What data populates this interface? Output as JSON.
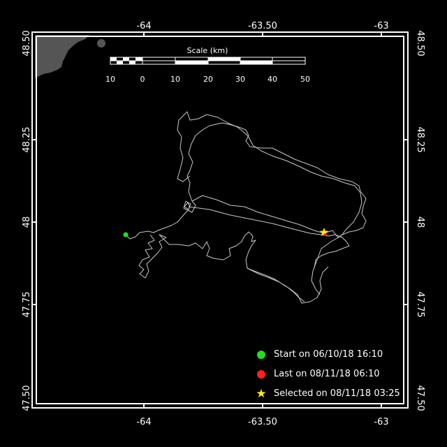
{
  "map": {
    "top_ticks": [
      "-64",
      "-63.50",
      "-63"
    ],
    "bottom_ticks": [
      "-64",
      "-63.50",
      "-63"
    ],
    "left_ticks": [
      "48.50",
      "48.25",
      "48",
      "47.75",
      "47.50"
    ],
    "right_ticks": [
      "48.50",
      "48.25",
      "48",
      "47.75",
      "47.50"
    ],
    "scale": {
      "title": "Scale (km)",
      "labels": [
        "10",
        "0",
        "10",
        "20",
        "30",
        "40",
        "50"
      ]
    },
    "colors": {
      "background": "#000000",
      "frame": "#ffffff",
      "land": "#555555",
      "track": "#c8c8c8",
      "start": "#22dd22",
      "last": "#ff2020",
      "selected": "#ffee00"
    }
  },
  "legend": {
    "start": {
      "label": "Start on 06/10/18 16:10",
      "icon": "green-circle"
    },
    "last": {
      "label": "Last on 08/11/18 06:10",
      "icon": "red-circle"
    },
    "selected": {
      "label": "Selected on 08/11/18 03:25",
      "icon": "yellow-star"
    }
  }
}
